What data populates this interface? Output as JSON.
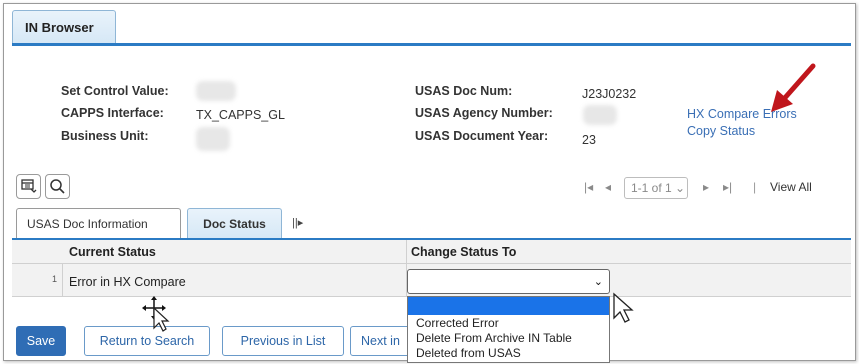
{
  "page_tab": "IN Browser",
  "header": {
    "set_control_label": "Set Control Value:",
    "capps_interface_label": "CAPPS Interface:",
    "capps_interface_value": "TX_CAPPS_GL",
    "business_unit_label": "Business Unit:",
    "usas_doc_num_label": "USAS Doc Num:",
    "usas_doc_num_value": "J23J0232",
    "usas_agency_label": "USAS Agency Number:",
    "usas_doc_year_label": "USAS Document Year:",
    "usas_doc_year_value": "23",
    "hx_compare_link": "HX Compare Errors",
    "copy_status_link": "Copy Status"
  },
  "grid": {
    "pager_text": "1-1 of 1",
    "view_all": "View All",
    "tabs": [
      "USAS Doc Information",
      "Doc Status"
    ],
    "columns": [
      "Current Status",
      "Change Status To"
    ],
    "rows": [
      {
        "num": "1",
        "current_status": "Error in HX Compare",
        "change_status_to": ""
      }
    ],
    "dropdown_options": [
      "",
      "Corrected Error",
      "Delete From Archive IN Table",
      "Deleted from USAS"
    ]
  },
  "buttons": {
    "save": "Save",
    "return_to_search": "Return to Search",
    "previous_in_list": "Previous in List",
    "next_in_list": "Next in"
  },
  "colors": {
    "accent_blue": "#2b7bc4",
    "link": "#3a6fb5",
    "annotation_arrow": "#c0161c",
    "highlight": "#1a73e8"
  }
}
